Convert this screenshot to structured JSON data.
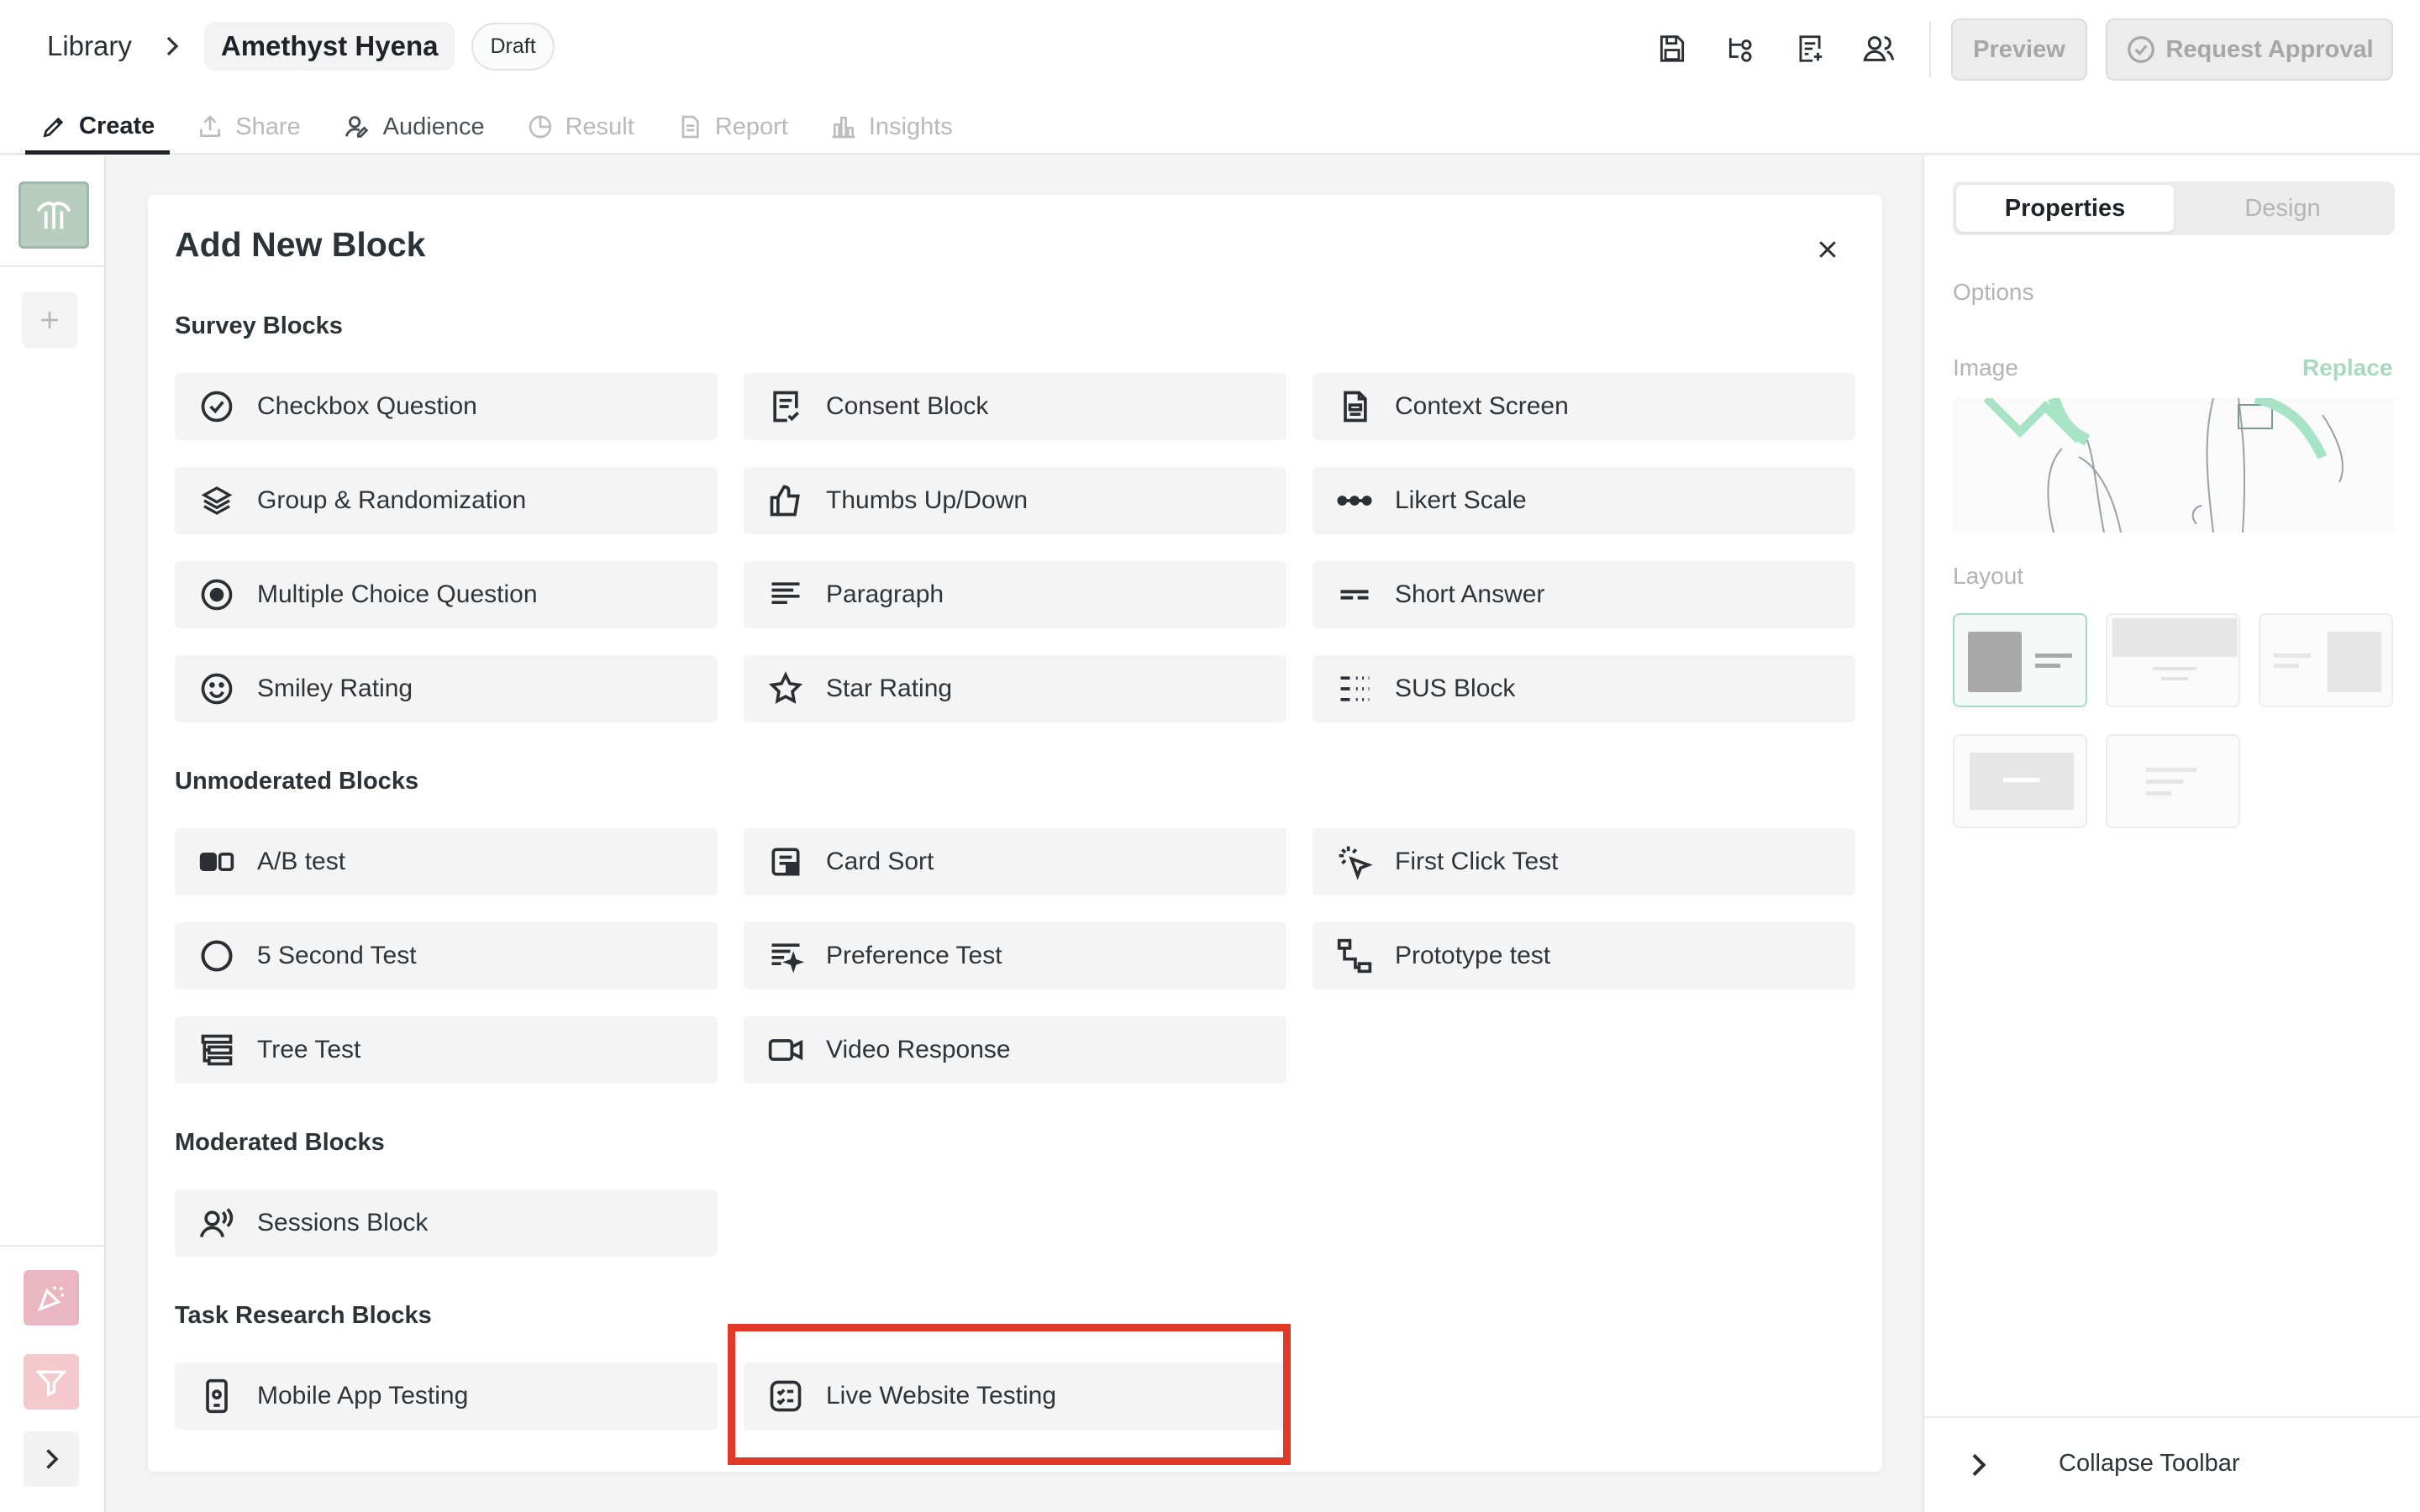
{
  "header": {
    "breadcrumb_root": "Library",
    "project_name": "Amethyst Hyena",
    "status_badge": "Draft",
    "preview_label": "Preview",
    "request_approval_label": "Request Approval"
  },
  "tabs": [
    {
      "label": "Create",
      "icon": "pencil-icon",
      "state": "active"
    },
    {
      "label": "Share",
      "icon": "share-icon",
      "state": "disabled"
    },
    {
      "label": "Audience",
      "icon": "audience-icon",
      "state": "enabled"
    },
    {
      "label": "Result",
      "icon": "pie-chart-icon",
      "state": "disabled"
    },
    {
      "label": "Report",
      "icon": "report-icon",
      "state": "disabled"
    },
    {
      "label": "Insights",
      "icon": "bar-chart-icon",
      "state": "disabled"
    }
  ],
  "modal": {
    "title": "Add New Block",
    "sections": [
      {
        "title": "Survey Blocks",
        "items": [
          "Checkbox Question",
          "Consent Block",
          "Context Screen",
          "Group & Randomization",
          "Thumbs Up/Down",
          "Likert Scale",
          "Multiple Choice Question",
          "Paragraph",
          "Short Answer",
          "Smiley Rating",
          "Star Rating",
          "SUS Block"
        ]
      },
      {
        "title": "Unmoderated Blocks",
        "items": [
          "A/B test",
          "Card Sort",
          "First Click Test",
          "5 Second Test",
          "Preference Test",
          "Prototype test",
          "Tree Test",
          "Video Response"
        ]
      },
      {
        "title": "Moderated Blocks",
        "items": [
          "Sessions Block"
        ]
      },
      {
        "title": "Task Research Blocks",
        "items": [
          "Mobile App Testing",
          "Live Website Testing"
        ]
      }
    ]
  },
  "right_panel": {
    "tabs": [
      "Properties",
      "Design"
    ],
    "options_label": "Options",
    "image_label": "Image",
    "replace_label": "Replace",
    "layout_label": "Layout",
    "collapse_label": "Collapse Toolbar"
  },
  "colors": {
    "highlight": "#e23a26",
    "accent_green": "#a6ddc2",
    "panel_bg": "#f4f4f4"
  }
}
